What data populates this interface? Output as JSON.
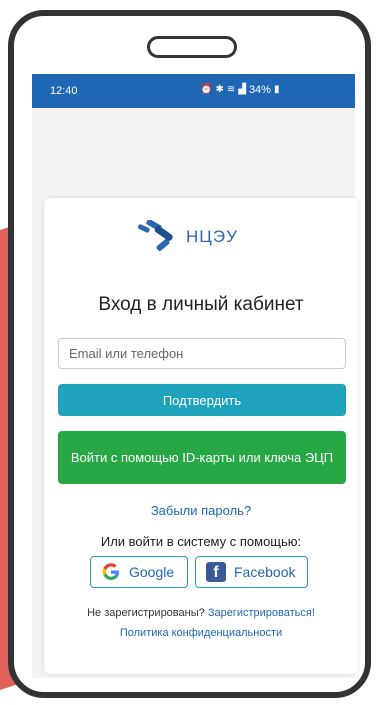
{
  "status": {
    "time": "12:40",
    "battery": "34%",
    "icons": [
      "alarm-icon",
      "bluetooth-icon",
      "wifi-icon",
      "signal-icon",
      "battery-icon"
    ]
  },
  "logo": {
    "text": "НЦЭУ"
  },
  "login": {
    "title": "Вход в личный кабинет",
    "email_placeholder": "Email или телефон",
    "email_value": "",
    "confirm_label": "Подтвердить",
    "id_card_label": "Войти с помощью ID-карты или ключа ЭЦП",
    "forgot_label": "Забыли пароль?",
    "or_text": "Или войти в систему с помощью:",
    "google_label": "Google",
    "facebook_label": "Facebook",
    "not_registered_text": "Не зарегистрированы?",
    "register_link": "Зарегистрироваться!",
    "privacy_link": "Политика конфиденциальности"
  },
  "colors": {
    "status_bar": "#1f66b4",
    "confirm_button": "#1fa2bb",
    "id_button": "#27a845",
    "link": "#1f66b4",
    "brand": "#2b66b3"
  }
}
